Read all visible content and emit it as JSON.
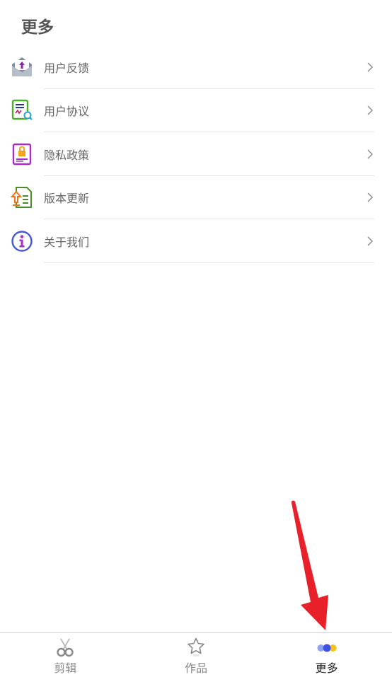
{
  "header": {
    "title": "更多"
  },
  "menu": {
    "items": [
      {
        "label": "用户反馈",
        "icon": "feedback-mail-icon"
      },
      {
        "label": "用户协议",
        "icon": "agreement-document-icon"
      },
      {
        "label": "隐私政策",
        "icon": "privacy-lock-icon"
      },
      {
        "label": "版本更新",
        "icon": "update-upload-icon"
      },
      {
        "label": "关于我们",
        "icon": "info-icon"
      }
    ]
  },
  "tabbar": {
    "tabs": [
      {
        "label": "剪辑",
        "icon": "scissors-icon",
        "active": false
      },
      {
        "label": "作品",
        "icon": "star-icon",
        "active": false
      },
      {
        "label": "更多",
        "icon": "dots-icon",
        "active": true
      }
    ]
  },
  "colors": {
    "title": "#555555",
    "label": "#666666",
    "divider": "#e3e3e3",
    "arrow": "#e8202a",
    "dot_blue_light": "#8fa3f5",
    "dot_blue": "#3f51e6",
    "dot_yellow": "#f5c21b"
  }
}
